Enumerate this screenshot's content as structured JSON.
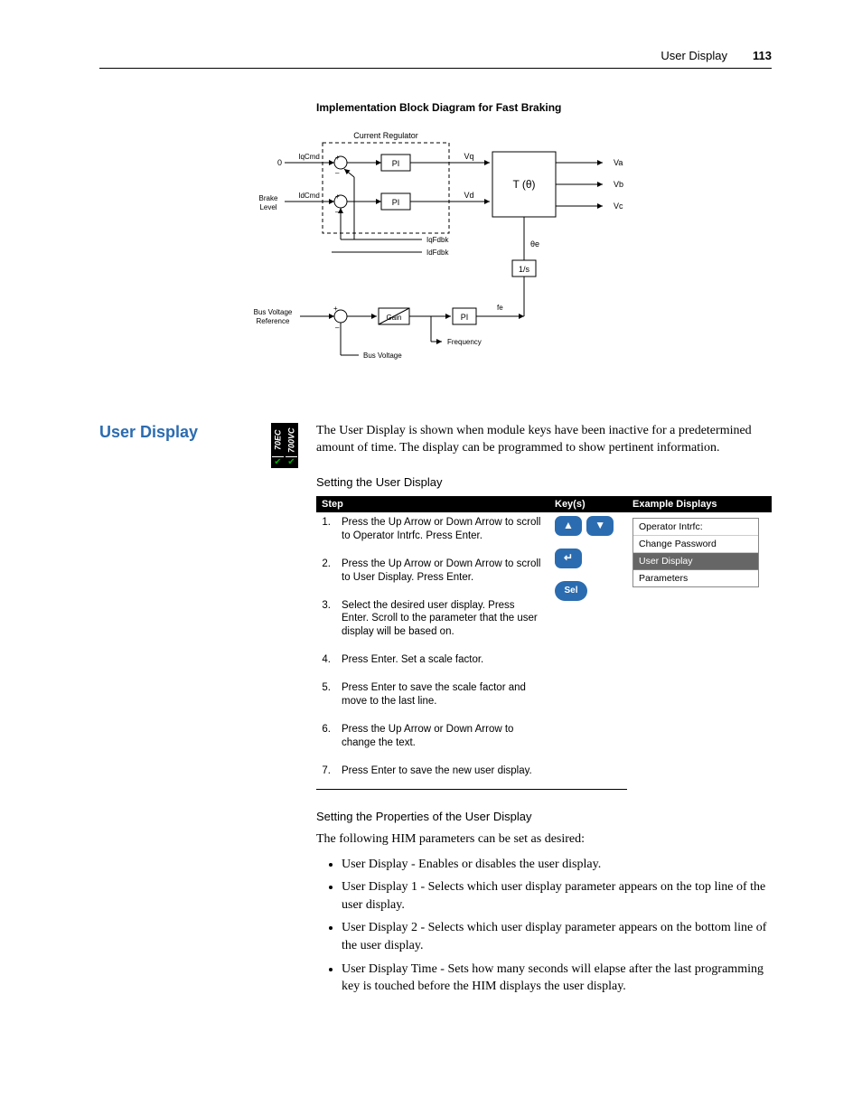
{
  "header": {
    "title": "User Display",
    "page": "113"
  },
  "figure": {
    "caption": "Implementation Block Diagram for Fast Braking",
    "labels": {
      "currentRegulator": "Current Regulator",
      "zero": "0",
      "iqcmd": "IqCmd",
      "brakeLevel1": "Brake",
      "brakeLevel2": "Level",
      "idcmd": "IdCmd",
      "pi": "PI",
      "vq": "Vq",
      "vd": "Vd",
      "t_theta": "T (θ)",
      "va": "Va",
      "vb": "Vb",
      "vc": "Vc",
      "iqfdbk": "IqFdbk",
      "idfdbk": "IdFdbk",
      "theta_e": "θe",
      "one_s": "1/s",
      "busVoltRef1": "Bus Voltage",
      "busVoltRef2": "Reference",
      "gain": "Gain",
      "fe": "fe",
      "frequency": "Frequency",
      "busVoltage": "Bus Voltage",
      "plus": "+",
      "minus": "–"
    }
  },
  "section": {
    "heading": "User Display",
    "badges": [
      "70EC",
      "700VC"
    ],
    "intro": "The User Display is shown when module keys have been inactive for a predetermined amount of time. The display can be programmed to show pertinent information.",
    "subheading": "Setting the User Display",
    "tableHeaders": {
      "step": "Step",
      "keys": "Key(s)",
      "example": "Example Displays"
    },
    "steps": [
      {
        "n": "1.",
        "text": "Press the Up Arrow or Down Arrow to scroll to Operator Intrfc. Press Enter."
      },
      {
        "n": "2.",
        "text": "Press the Up Arrow or Down Arrow to scroll to User Display. Press Enter."
      },
      {
        "n": "3.",
        "text": "Select the desired user display. Press Enter. Scroll to the parameter that the user display will be based on."
      },
      {
        "n": "4.",
        "text": "Press Enter. Set a scale factor."
      },
      {
        "n": "5.",
        "text": "Press Enter to save the scale factor and move to the last line."
      },
      {
        "n": "6.",
        "text": "Press the Up Arrow or Down Arrow to change the text."
      },
      {
        "n": "7.",
        "text": "Press Enter to save the new user display."
      }
    ],
    "keyIcons": {
      "up": "▲",
      "down": "▼",
      "enter": "↵",
      "sel": "Sel"
    },
    "exampleDisplay": {
      "title": "Operator Intrfc:",
      "rows": [
        "Change Password",
        "User Display",
        "Parameters"
      ],
      "selectedIndex": 1
    },
    "propsHeading": "Setting the Properties of the User Display",
    "propsIntro": "The following HIM parameters can be set as desired:",
    "propsBullets": [
      "User Display - Enables or disables the user display.",
      "User Display 1 - Selects which user display parameter appears on the top line of the user display.",
      "User Display 2 - Selects which user display parameter appears on the bottom line of the user display.",
      "User Display Time - Sets how many seconds will elapse after the last programming key is touched before the HIM displays the user display."
    ]
  }
}
